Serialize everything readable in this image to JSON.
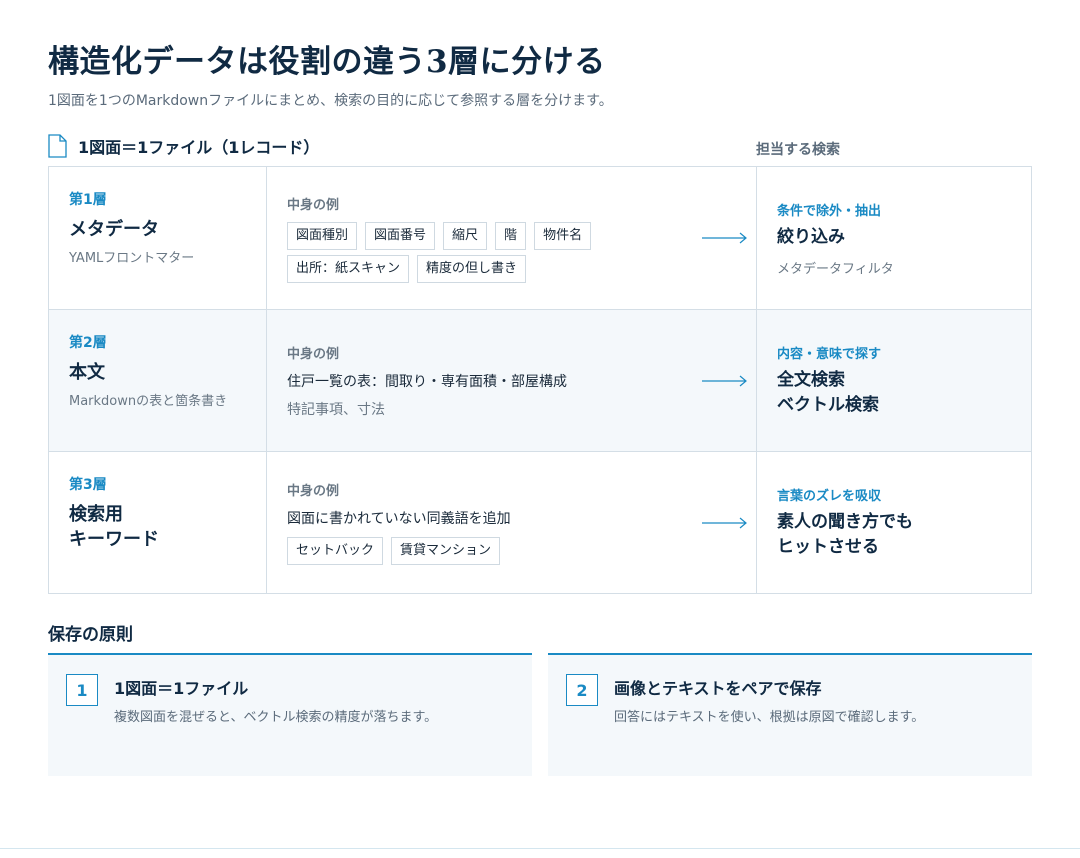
{
  "header": {
    "title": "構造化データは役割の違う3層に分ける",
    "subtitle": "1図面を1つのMarkdownファイルにまとめ、検索の目的に応じて参照する層を分けます。"
  },
  "table_head": {
    "file_label": "1図面＝1ファイル（1レコード）",
    "search_label": "担当する検索"
  },
  "layers": [
    {
      "no": "第1層",
      "name": "メタデータ",
      "desc": "YAMLフロントマター",
      "example_label": "中身の例",
      "tags": [
        "図面種別",
        "図面番号",
        "縮尺",
        "階",
        "物件名",
        "出所：紙スキャン",
        "精度の但し書き"
      ],
      "goal": "条件で除外・抽出",
      "target": "絞り込み",
      "target_desc": "メタデータフィルタ"
    },
    {
      "no": "第2層",
      "name": "本文",
      "desc": "Markdownの表と箇条書き",
      "example_label": "中身の例",
      "main": "住戸一覧の表：間取り・専有面積・部屋構成",
      "sub": "特記事項、寸法",
      "goal": "内容・意味で探す",
      "target": "全文検索\nベクトル検索"
    },
    {
      "no": "第3層",
      "name": "検索用\nキーワード",
      "example_label": "中身の例",
      "main": "図面に書かれていない同義語を追加",
      "tags": [
        "セットバック",
        "賃貸マンション"
      ],
      "goal": "言葉のズレを吸収",
      "target": "素人の聞き方でも\nヒットさせる"
    }
  ],
  "principles": {
    "title": "保存の原則",
    "cards": [
      {
        "num": "1",
        "title": "1図面＝1ファイル",
        "desc": "複数図面を混ぜると、ベクトル検索の精度が落ちます。"
      },
      {
        "num": "2",
        "title": "画像とテキストをペアで保存",
        "desc": "回答にはテキストを使い、根拠は原図で確認します。"
      }
    ]
  },
  "colors": {
    "accent": "#1a8ac4",
    "heading": "#102a43",
    "border": "#d4dee6",
    "shade": "#f4f8fb"
  }
}
